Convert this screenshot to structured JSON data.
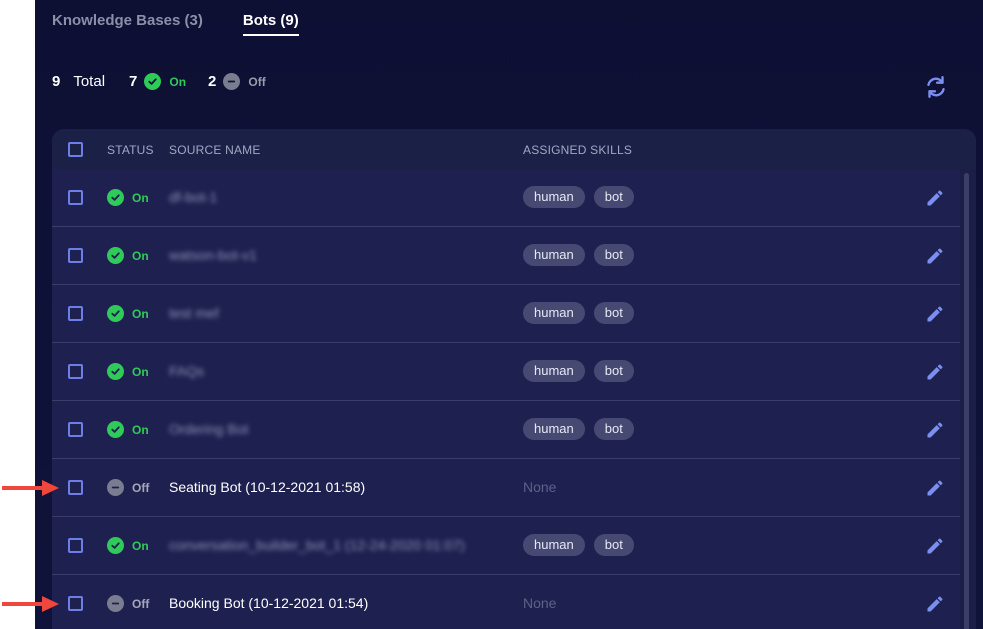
{
  "tabs": [
    {
      "label": "Knowledge Bases (3)",
      "active": false
    },
    {
      "label": "Bots (9)",
      "active": true
    }
  ],
  "summary": {
    "total_count": "9",
    "total_label": "Total",
    "on_count": "7",
    "on_label": "On",
    "off_count": "2",
    "off_label": "Off"
  },
  "table": {
    "headers": {
      "status": "STATUS",
      "source_name": "SOURCE NAME",
      "assigned_skills": "ASSIGNED SKILLS"
    },
    "rows": [
      {
        "status": "On",
        "name": "df-bot-1",
        "blurred": true,
        "skills": [
          "human",
          "bot"
        ]
      },
      {
        "status": "On",
        "name": "watson-bot-v1",
        "blurred": true,
        "skills": [
          "human",
          "bot"
        ]
      },
      {
        "status": "On",
        "name": "test mef",
        "blurred": true,
        "skills": [
          "human",
          "bot"
        ]
      },
      {
        "status": "On",
        "name": "FAQs",
        "blurred": true,
        "skills": [
          "human",
          "bot"
        ]
      },
      {
        "status": "On",
        "name": "Ordering Bot",
        "blurred": true,
        "skills": [
          "human",
          "bot"
        ]
      },
      {
        "status": "Off",
        "name": "Seating Bot (10-12-2021 01:58)",
        "blurred": false,
        "skills": [],
        "skills_empty_text": "None"
      },
      {
        "status": "On",
        "name": "conversation_builder_bot_1 (12-24-2020 01:07)",
        "blurred": true,
        "skills": [
          "human",
          "bot"
        ]
      },
      {
        "status": "Off",
        "name": "Booking Bot (10-12-2021 01:54)",
        "blurred": false,
        "skills": [],
        "skills_empty_text": "None"
      }
    ]
  },
  "colors": {
    "background": "#0d0f33",
    "on": "#2fcb58",
    "off": "#7a7c8f",
    "accent": "#6c7fe8",
    "annotation_arrow": "#f0463c"
  },
  "icons": {
    "refresh": "refresh-icon",
    "edit": "pencil-icon",
    "on": "check-circle-icon",
    "off": "minus-circle-icon"
  }
}
